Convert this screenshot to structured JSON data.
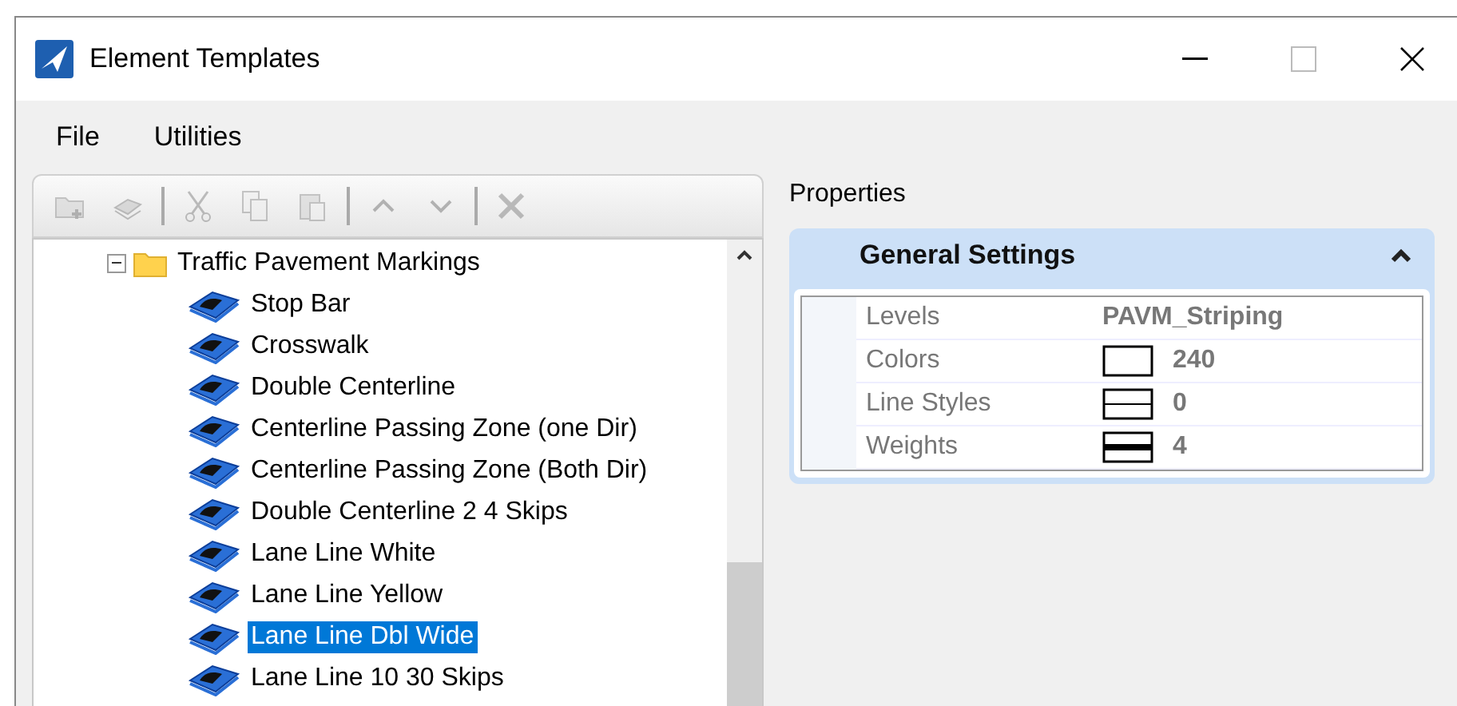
{
  "window": {
    "title": "Element Templates"
  },
  "menu": [
    "File",
    "Utilities"
  ],
  "toolbar": [
    {
      "kind": "add_folder",
      "disabled": true
    },
    {
      "kind": "add_template",
      "disabled": true
    },
    {
      "kind": "separator"
    },
    {
      "kind": "cut",
      "disabled": true
    },
    {
      "kind": "copy",
      "disabled": true
    },
    {
      "kind": "paste",
      "disabled": true
    },
    {
      "kind": "separator"
    },
    {
      "kind": "up",
      "disabled": true
    },
    {
      "kind": "down",
      "disabled": true
    },
    {
      "kind": "separator"
    },
    {
      "kind": "delete",
      "disabled": true
    }
  ],
  "tree": [
    {
      "label": "Traffic Pavement Markings",
      "expanded": true,
      "selected": false,
      "children": [
        {
          "label": "Stop Bar",
          "selected": false
        },
        {
          "label": "Crosswalk",
          "selected": false
        },
        {
          "label": "Double Centerline",
          "selected": false
        },
        {
          "label": "Centerline Passing Zone (one Dir)",
          "selected": false
        },
        {
          "label": "Centerline Passing Zone (Both Dir)",
          "selected": false
        },
        {
          "label": "Double Centerline 2 4 Skips",
          "selected": false
        },
        {
          "label": "Lane Line White",
          "selected": false
        },
        {
          "label": "Lane Line Yellow",
          "selected": false
        },
        {
          "label": "Lane Line Dbl Wide",
          "selected": true
        },
        {
          "label": "Lane Line 10 30 Skips",
          "selected": false
        }
      ]
    }
  ],
  "properties": {
    "title": "Properties",
    "section": {
      "title": "General Settings",
      "expanded": true,
      "rows": [
        {
          "label": "Levels",
          "value": "PAVM_Striping",
          "kind": "text"
        },
        {
          "label": "Colors",
          "value": "240",
          "kind": "color"
        },
        {
          "label": "Line Styles",
          "value": "0",
          "kind": "line_style"
        },
        {
          "label": "Weights",
          "value": "4",
          "kind": "weight"
        }
      ]
    }
  }
}
